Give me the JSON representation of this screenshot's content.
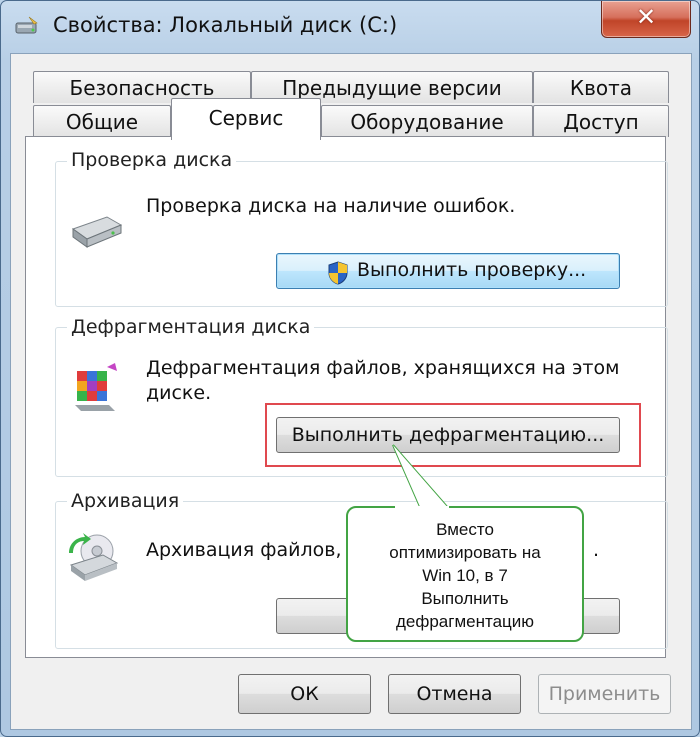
{
  "window": {
    "title": "Свойства: Локальный диск (C:)",
    "close_label": "✕"
  },
  "tabs": {
    "row1": [
      "Безопасность",
      "Предыдущие версии",
      "Квота"
    ],
    "row2": [
      "Общие",
      "Сервис",
      "Оборудование",
      "Доступ"
    ],
    "active": "Сервис"
  },
  "check": {
    "title": "Проверка диска",
    "text": "Проверка диска на наличие ошибок.",
    "button": "Выполнить проверку..."
  },
  "defrag": {
    "title": "Дефрагментация диска",
    "text_line1": "Дефрагментация файлов, хранящихся на этом",
    "text_line2": "диске.",
    "button": "Выполнить дефрагментацию..."
  },
  "backup": {
    "title": "Архивация",
    "text_visible_left": "Архивация файлов, х",
    "text_visible_right": "."
  },
  "callout": {
    "lines": [
      "Вместо",
      "оптимизировать на",
      "Win 10, в 7",
      "Выполнить",
      "дефрагментацию"
    ]
  },
  "footer": {
    "ok": "ОК",
    "cancel": "Отмена",
    "apply": "Применить"
  },
  "colors": {
    "highlight_border": "#e0494f",
    "callout_border": "#43a444",
    "close_button": "#c04428"
  }
}
